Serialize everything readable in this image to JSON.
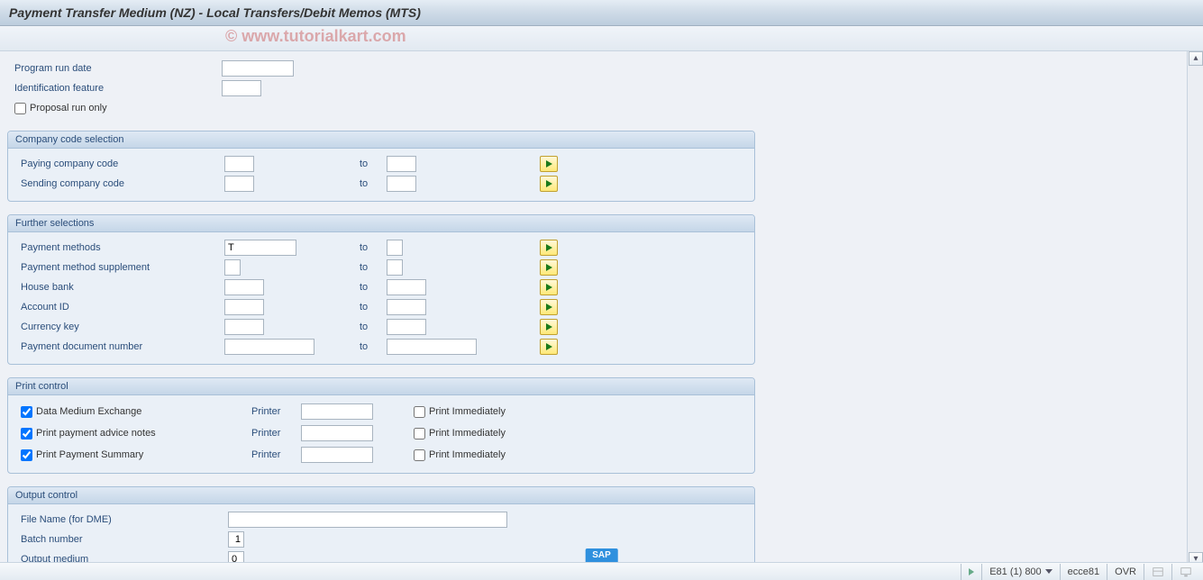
{
  "title": "Payment Transfer Medium (NZ) - Local Transfers/Debit Memos (MTS)",
  "watermark": "© www.tutorialkart.com",
  "top_fields": {
    "program_run_date": {
      "label": "Program run date",
      "value": ""
    },
    "identification_feature": {
      "label": "Identification feature",
      "value": ""
    },
    "proposal_run_only": {
      "label": "Proposal run only"
    }
  },
  "groups": {
    "company_code": {
      "title": "Company code selection",
      "rows": [
        {
          "label": "Paying company code",
          "from": "",
          "to_label": "to",
          "to": ""
        },
        {
          "label": "Sending company code",
          "from": "",
          "to_label": "to",
          "to": ""
        }
      ]
    },
    "further": {
      "title": "Further selections",
      "rows": [
        {
          "label": "Payment methods",
          "from": "T",
          "to_label": "to",
          "to": ""
        },
        {
          "label": "Payment method supplement",
          "from": "",
          "to_label": "to",
          "to": ""
        },
        {
          "label": "House bank",
          "from": "",
          "to_label": "to",
          "to": ""
        },
        {
          "label": "Account ID",
          "from": "",
          "to_label": "to",
          "to": ""
        },
        {
          "label": "Currency key",
          "from": "",
          "to_label": "to",
          "to": ""
        },
        {
          "label": "Payment document number",
          "from": "",
          "to_label": "to",
          "to": ""
        }
      ]
    },
    "print_control": {
      "title": "Print control",
      "printer_label": "Printer",
      "immediate_label": "Print Immediately",
      "rows": [
        {
          "check_label": "Data Medium Exchange",
          "checked": true,
          "printer": "",
          "immediate": false
        },
        {
          "check_label": "Print payment advice notes",
          "checked": true,
          "printer": "",
          "immediate": false
        },
        {
          "check_label": "Print Payment Summary",
          "checked": true,
          "printer": "",
          "immediate": false
        }
      ]
    },
    "output_control": {
      "title": "Output control",
      "file_name": {
        "label": "File Name (for DME)",
        "value": ""
      },
      "batch_number": {
        "label": "Batch number",
        "value": "1"
      },
      "output_medium": {
        "label": "Output medium",
        "value": "0"
      }
    }
  },
  "status": {
    "session": "E81 (1) 800",
    "server": "ecce81",
    "mode": "OVR"
  },
  "sap_logo": "SAP"
}
